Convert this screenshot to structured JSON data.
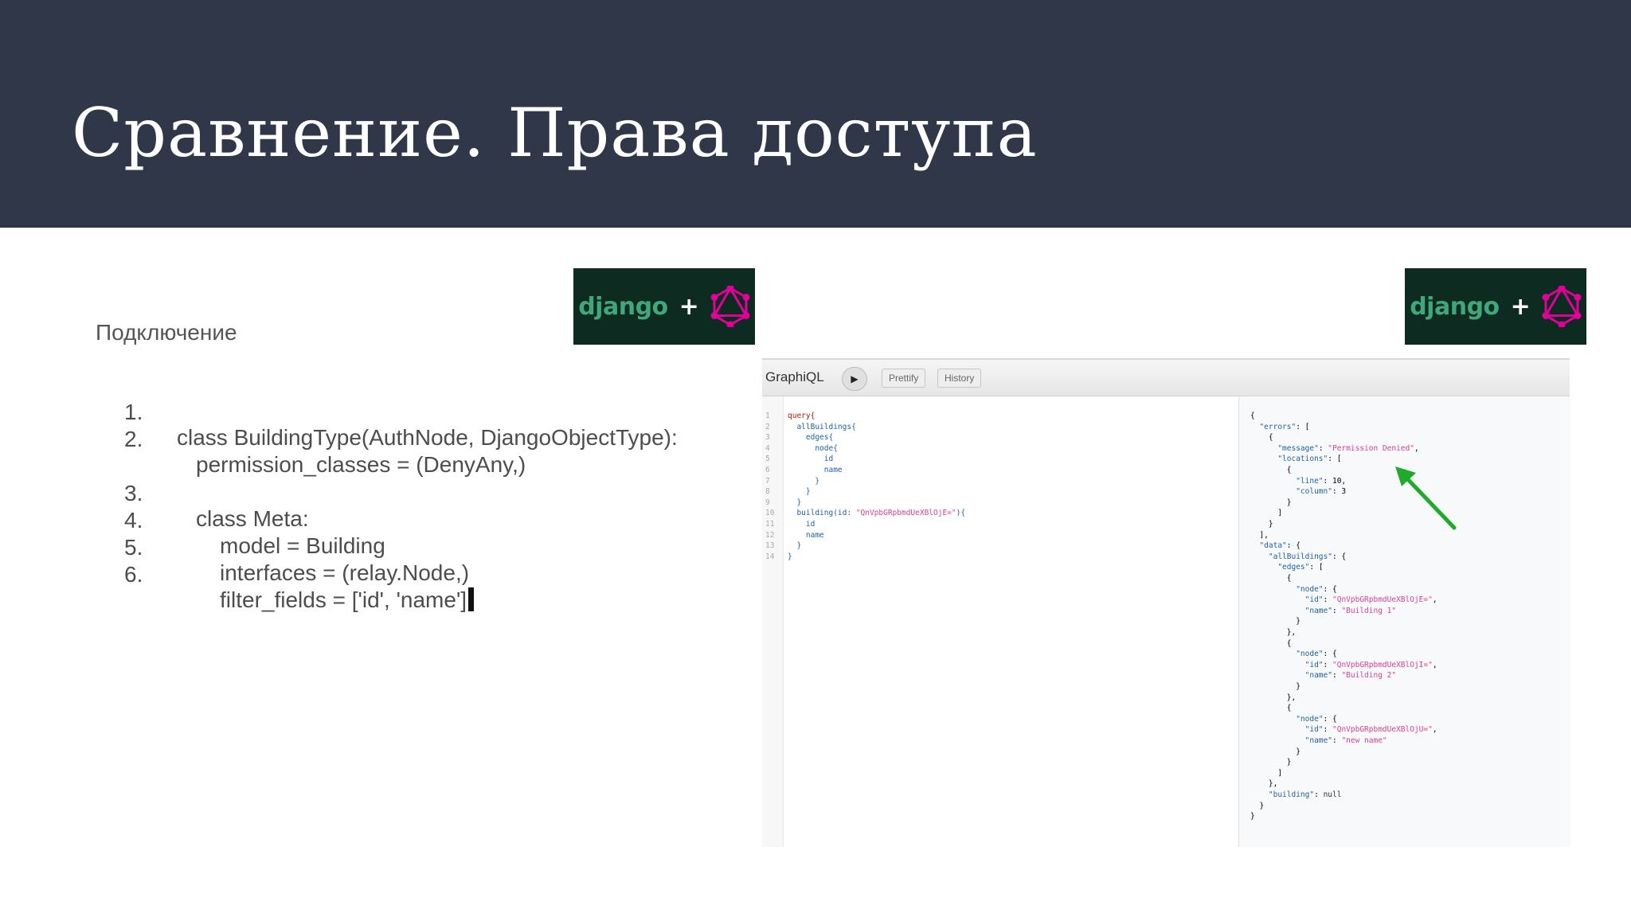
{
  "slide": {
    "title": "Сравнение. Права доступа",
    "subtitle": "Подключение"
  },
  "badges": {
    "left": {
      "text": "django",
      "plus": "+",
      "icon": "graphql-logo-icon"
    },
    "right": {
      "text": "django",
      "plus": "+",
      "icon": "graphql-logo-icon"
    }
  },
  "code_lines": [
    {
      "num": "1.",
      "text": "class BuildingType(AuthNode, DjangoObjectType):"
    },
    {
      "num": "2.",
      "text": "permission_classes = (DenyAny,)"
    },
    {
      "num": "3.",
      "text": "class Meta:"
    },
    {
      "num": "4.",
      "text": "model = Building"
    },
    {
      "num": "5.",
      "text": "interfaces = (relay.Node,)"
    },
    {
      "num": "6.",
      "text": "filter_fields = ['id', 'name']"
    }
  ],
  "graphiql": {
    "logo": "GraphiQL",
    "run_icon": "play-icon",
    "prettify_label": "Prettify",
    "history_label": "History",
    "arrow_color": "#1faa2a",
    "query_lines": [
      {
        "ln": "1",
        "text": "query{"
      },
      {
        "ln": "2",
        "text": "  allBuildings{"
      },
      {
        "ln": "3",
        "text": "    edges{"
      },
      {
        "ln": "4",
        "text": "      node{"
      },
      {
        "ln": "5",
        "text": "        id"
      },
      {
        "ln": "6",
        "text": "        name"
      },
      {
        "ln": "7",
        "text": "      }"
      },
      {
        "ln": "8",
        "text": "    }"
      },
      {
        "ln": "9",
        "text": "  }"
      },
      {
        "ln": "10",
        "text": "  building(id: \"QnVpbGRpbmdUeXBlOjE=\"){"
      },
      {
        "ln": "11",
        "text": "    id"
      },
      {
        "ln": "12",
        "text": "    name"
      },
      {
        "ln": "13",
        "text": "  }"
      },
      {
        "ln": "14",
        "text": "}"
      }
    ],
    "result_lines": [
      "{",
      "  \"errors\": [",
      "    {",
      "      \"message\": \"Permission Denied\",",
      "      \"locations\": [",
      "        {",
      "          \"line\": 10,",
      "          \"column\": 3",
      "        }",
      "      ]",
      "    }",
      "  ],",
      "  \"data\": {",
      "    \"allBuildings\": {",
      "      \"edges\": [",
      "        {",
      "          \"node\": {",
      "            \"id\": \"QnVpbGRpbmdUeXBlOjE=\",",
      "            \"name\": \"Building 1\"",
      "          }",
      "        },",
      "        {",
      "          \"node\": {",
      "            \"id\": \"QnVpbGRpbmdUeXBlOjI=\",",
      "            \"name\": \"Building 2\"",
      "          }",
      "        },",
      "        {",
      "          \"node\": {",
      "            \"id\": \"QnVpbGRpbmdUeXBlOjU=\",",
      "            \"name\": \"new name\"",
      "          }",
      "        }",
      "      ]",
      "    },",
      "    \"building\": null",
      "  }",
      "}"
    ]
  }
}
